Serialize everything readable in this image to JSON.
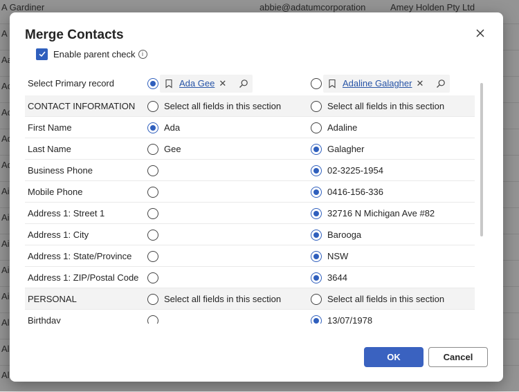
{
  "background": {
    "rows": [
      {
        "col1": "A Gardiner",
        "col2": "abbie@adatumcorporation",
        "col3": "Amey Holden Pty Ltd"
      },
      {
        "col1": "A",
        "col2": "",
        "col3": ""
      },
      {
        "col1": "Aa",
        "col2": "",
        "col3": ""
      },
      {
        "col1": "Ac",
        "col2": "",
        "col3": ""
      },
      {
        "col1": "Ac",
        "col2": "",
        "col3": ""
      },
      {
        "col1": "Ad",
        "col2": "",
        "col3": ""
      },
      {
        "col1": "Ad",
        "col2": "",
        "col3": ""
      },
      {
        "col1": "Ai",
        "col2": "",
        "col3": ""
      },
      {
        "col1": "Ai",
        "col2": "",
        "col3": ""
      },
      {
        "col1": "Ai",
        "col2": "",
        "col3": ""
      },
      {
        "col1": "Ai",
        "col2": "",
        "col3": ""
      },
      {
        "col1": "Ai",
        "col2": "",
        "col3": ""
      },
      {
        "col1": "Al",
        "col2": "",
        "col3": ""
      },
      {
        "col1": "Al",
        "col2": "",
        "col3": ""
      },
      {
        "col1": "Al",
        "col2": "",
        "col3": ""
      }
    ]
  },
  "dialog": {
    "title": "Merge Contacts",
    "enable_parent_check_label": "Enable parent check",
    "enable_parent_check_checked": true,
    "primary_record_label": "Select Primary record",
    "record1_name": "Ada Gee",
    "record2_name": "Adaline Galagher",
    "primary_selected": 1,
    "ok_label": "OK",
    "cancel_label": "Cancel"
  },
  "rows": [
    {
      "label": "CONTACT INFORMATION",
      "section": true,
      "opt1": "Select all fields in this section",
      "opt2": "Select all fields in this section",
      "selected": 0
    },
    {
      "label": "First Name",
      "section": false,
      "opt1": "Ada",
      "opt2": "Adaline",
      "selected": 1
    },
    {
      "label": "Last Name",
      "section": false,
      "opt1": "Gee",
      "opt2": "Galagher",
      "selected": 2
    },
    {
      "label": "Business Phone",
      "section": false,
      "opt1": "",
      "opt2": "02-3225-1954",
      "selected": 2
    },
    {
      "label": "Mobile Phone",
      "section": false,
      "opt1": "",
      "opt2": "0416-156-336",
      "selected": 2
    },
    {
      "label": "Address 1: Street 1",
      "section": false,
      "opt1": "",
      "opt2": "32716 N Michigan Ave #82",
      "selected": 2
    },
    {
      "label": "Address 1: City",
      "section": false,
      "opt1": "",
      "opt2": "Barooga",
      "selected": 2
    },
    {
      "label": "Address 1: State/Province",
      "section": false,
      "opt1": "",
      "opt2": "NSW",
      "selected": 2
    },
    {
      "label": "Address 1: ZIP/Postal Code",
      "section": false,
      "opt1": "",
      "opt2": "3644",
      "selected": 2
    },
    {
      "label": "PERSONAL",
      "section": true,
      "opt1": "Select all fields in this section",
      "opt2": "Select all fields in this section",
      "selected": 0
    },
    {
      "label": "Birthday",
      "section": false,
      "opt1": "",
      "opt2": "13/07/1978",
      "selected": 2
    }
  ],
  "colors": {
    "accent": "#2f5fbd",
    "link": "#2653a6",
    "ok_button": "#3a62c0",
    "section_bg": "#f3f3f3"
  },
  "icons": {
    "close": "close-icon",
    "record": "contact-record-icon",
    "search": "search-icon",
    "remove": "remove-icon",
    "info": "info-icon",
    "check": "checkmark-icon"
  }
}
